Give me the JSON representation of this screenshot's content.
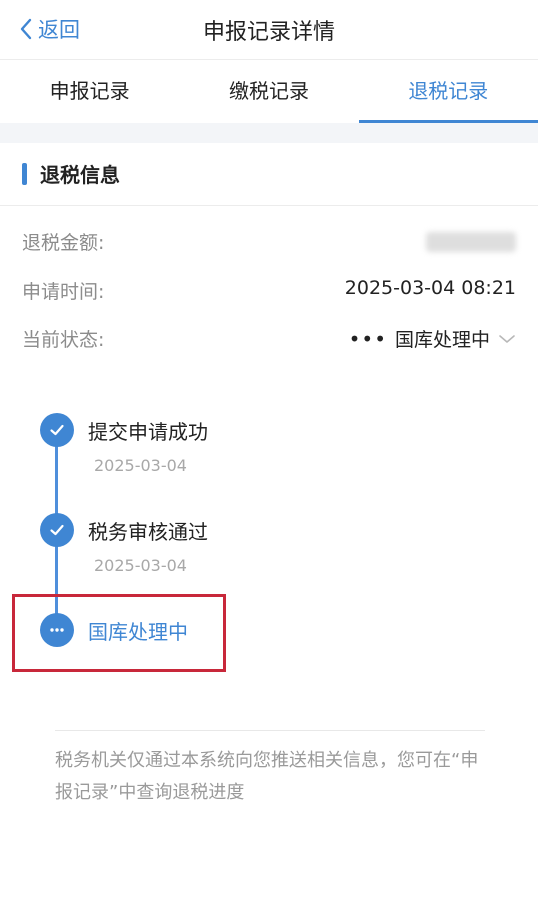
{
  "nav": {
    "back_label": "返回",
    "title": "申报记录详情"
  },
  "tabs": [
    {
      "label": "申报记录",
      "active": false
    },
    {
      "label": "缴税记录",
      "active": false
    },
    {
      "label": "退税记录",
      "active": true
    }
  ],
  "section": {
    "title": "退税信息"
  },
  "info": {
    "amount_key": "退税金额:",
    "time_key": "申请时间:",
    "time_value": "2025-03-04 08:21",
    "status_key": "当前状态:",
    "status_value": "国库处理中",
    "status_icon": "ellipsis-icon"
  },
  "timeline": [
    {
      "title": "提交申请成功",
      "date": "2025-03-04",
      "state": "done"
    },
    {
      "title": "税务审核通过",
      "date": "2025-03-04",
      "state": "done"
    },
    {
      "title": "国库处理中",
      "date": "",
      "state": "current"
    }
  ],
  "footer": {
    "note": "税务机关仅通过本系统向您推送相关信息，您可在“申报记录”中查询退税进度"
  },
  "colors": {
    "accent": "#3f86d3",
    "highlight": "#c8283a",
    "muted": "#8c8c8c"
  }
}
